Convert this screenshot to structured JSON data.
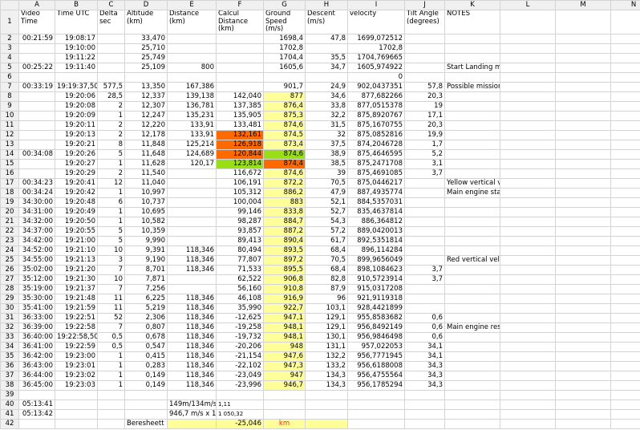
{
  "columns": [
    "",
    "A",
    "B",
    "C",
    "D",
    "E",
    "F",
    "G",
    "H",
    "I",
    "J",
    "K",
    "L",
    "M",
    "N",
    "O"
  ],
  "header_row": {
    "num": "1",
    "cells": [
      "Video Time",
      "Time UTC",
      "Delta sec",
      "Altitude (km)",
      "Distance (km)",
      "Calcul Distance (km)",
      "Ground Speed (m/s)",
      "Descent (m/s)",
      "velocity",
      "Tilt Angle (degrees)",
      "NOTES",
      "",
      "",
      ""
    ]
  },
  "colors": {
    "orange": "#ff6a00",
    "green": "#9ade18",
    "yellow": "#ffff9a",
    "header_bg": "#f0f0f0",
    "grid": "#d4d4d4",
    "red_text": "#ff2a2a"
  },
  "rows": [
    {
      "num": "2",
      "cells": [
        "00:21:59",
        "19:08:17",
        "",
        "33,470",
        "",
        "",
        "1698,4",
        "47,8",
        "1699,072512",
        "",
        "",
        "",
        "",
        ""
      ]
    },
    {
      "num": "3",
      "cells": [
        "",
        "19:10:00",
        "",
        "25,710",
        "",
        "",
        "1702,8",
        "",
        "1702,8",
        "",
        "",
        "",
        "",
        ""
      ]
    },
    {
      "num": "4",
      "cells": [
        "",
        "19:11:22",
        "",
        "25,749",
        "",
        "",
        "1704,4",
        "35,5",
        "1704,769665",
        "",
        "",
        "",
        "",
        ""
      ]
    },
    {
      "num": "5",
      "cells": [
        "00:25:22",
        "19:11:40",
        "",
        "25,109",
        "800",
        "",
        "1605,6",
        "34,7",
        "1605,974922",
        "",
        "Start Landing maneuver",
        "",
        "",
        ""
      ]
    },
    {
      "num": "6",
      "cells": [
        "",
        "",
        "",
        "",
        "",
        "",
        "",
        "",
        "0",
        "",
        "",
        "",
        "",
        ""
      ]
    },
    {
      "num": "7",
      "cells": [
        "00:33:19",
        "19:19:37,50",
        "577,5",
        "13,350",
        "167,386",
        "",
        "901,7",
        "24,9",
        "902,0437351",
        "57,8",
        "Possible mission anomaly began here, Main engine off?",
        "",
        "",
        ""
      ]
    },
    {
      "num": "8",
      "cells": [
        "",
        "19:20:06",
        "28,5",
        "12,337",
        "139,138",
        "142,040",
        "877",
        "34,6",
        "877,682266",
        "20,3",
        "",
        "",
        "",
        ""
      ]
    },
    {
      "num": "9",
      "cells": [
        "",
        "19:20:08",
        "2",
        "12,307",
        "136,781",
        "137,385",
        "876,4",
        "33,8",
        "877,0515378",
        "19",
        "",
        "",
        "",
        ""
      ]
    },
    {
      "num": "10",
      "cells": [
        "",
        "19:20:09",
        "1",
        "12,247",
        "135,231",
        "135,905",
        "875,3",
        "32,2",
        "875,8920767",
        "17,1",
        "",
        "",
        "",
        ""
      ]
    },
    {
      "num": "11",
      "cells": [
        "",
        "19:20:11",
        "2",
        "12,220",
        "133,91",
        "133,481",
        "874,6",
        "31,5",
        "875,1670755",
        "20,3",
        "",
        "",
        "",
        ""
      ]
    },
    {
      "num": "12",
      "cells": [
        "",
        "19:20:13",
        "2",
        "12,178",
        "133,91",
        "132,161",
        "874,5",
        "32",
        "875,0852816",
        "19,9",
        "",
        "",
        "",
        ""
      ]
    },
    {
      "num": "13",
      "cells": [
        "",
        "19:20:21",
        "8",
        "11,848",
        "125,214",
        "126,918",
        "873,4",
        "37,5",
        "874,2046728",
        "1,7",
        "",
        "",
        "",
        ""
      ]
    },
    {
      "num": "14",
      "cells": [
        "00:34:08",
        "19:20:26",
        "5",
        "11,648",
        "124,689",
        "120,844",
        "874,6",
        "38,9",
        "875,4646595",
        "5,2",
        "",
        "",
        "",
        ""
      ]
    },
    {
      "num": "15",
      "cells": [
        "",
        "19:20:27",
        "1",
        "11,628",
        "120,17",
        "123,814",
        "874,4",
        "38,5",
        "875,2471708",
        "3,1",
        "",
        "",
        "",
        ""
      ]
    },
    {
      "num": "16",
      "cells": [
        "",
        "19:20:29",
        "2",
        "11,540",
        "",
        "116,672",
        "874,6",
        "39",
        "875,4691085",
        "3,7",
        "",
        "",
        "",
        ""
      ]
    },
    {
      "num": "17",
      "cells": [
        "00:34:23",
        "19:20:41",
        "12",
        "11,040",
        "",
        "106,191",
        "872,2",
        "70,5",
        "875,0446217",
        "",
        "Yellow vertical velocity alarm",
        "",
        "",
        ""
      ]
    },
    {
      "num": "18",
      "cells": [
        "00:34:24",
        "19:20:42",
        "1",
        "10,997",
        "",
        "105,312",
        "886,2",
        "47,9",
        "887,4935774",
        "",
        "Main engine starts again? Followed by intermittent firings,",
        "",
        "",
        ""
      ]
    },
    {
      "num": "19",
      "cells": [
        "34:30:00",
        "19:20:48",
        "6",
        "10,737",
        "",
        "100,004",
        "883",
        "52,1",
        "884,5357031",
        "",
        "",
        "",
        "",
        ""
      ]
    },
    {
      "num": "20",
      "cells": [
        "34:31:00",
        "19:20:49",
        "1",
        "10,695",
        "",
        "99,146",
        "833,8",
        "52,7",
        "835,4637814",
        "",
        "",
        "",
        "",
        ""
      ]
    },
    {
      "num": "21",
      "cells": [
        "34:32:00",
        "19:20:50",
        "1",
        "10,582",
        "",
        "98,287",
        "884,7",
        "54,3",
        "886,364812",
        "",
        "",
        "",
        "",
        ""
      ]
    },
    {
      "num": "22",
      "cells": [
        "34:37:00",
        "19:20:55",
        "5",
        "10,359",
        "",
        "93,857",
        "887,2",
        "57,2",
        "889,0420013",
        "",
        "",
        "",
        "",
        ""
      ]
    },
    {
      "num": "23",
      "cells": [
        "34:42:00",
        "19:21:00",
        "5",
        "9,990",
        "",
        "89,413",
        "890,4",
        "61,7",
        "892,5351814",
        "",
        "",
        "",
        "",
        ""
      ]
    },
    {
      "num": "24",
      "cells": [
        "34:52:00",
        "19:21:10",
        "10",
        "9,391",
        "118,346",
        "80,494",
        "893,5",
        "68,4",
        "896,114284",
        "",
        "",
        "",
        "",
        ""
      ]
    },
    {
      "num": "25",
      "cells": [
        "34:55:00",
        "19:21:13",
        "3",
        "9,190",
        "118,346",
        "77,807",
        "897,2",
        "70,5",
        "899,9656049",
        "",
        "Red vertical velocity alarm",
        "",
        "",
        ""
      ]
    },
    {
      "num": "26",
      "cells": [
        "35:02:00",
        "19:21:20",
        "7",
        "8,701",
        "118,346",
        "71,533",
        "895,5",
        "68,4",
        "898,1084623",
        "3,7",
        "",
        "",
        "",
        ""
      ]
    },
    {
      "num": "27",
      "cells": [
        "35:12:00",
        "19:21:30",
        "10",
        "7,871",
        "",
        "62,522",
        "906,8",
        "82,8",
        "910,5723914",
        "3,7",
        "",
        "",
        "",
        ""
      ]
    },
    {
      "num": "28",
      "cells": [
        "35:19:00",
        "19:21:37",
        "7",
        "7,256",
        "",
        "56,160",
        "910,8",
        "87,9",
        "915,0317208",
        "",
        "",
        "",
        "",
        ""
      ]
    },
    {
      "num": "29",
      "cells": [
        "35:30:00",
        "19:21:48",
        "11",
        "6,225",
        "118,346",
        "46,108",
        "916,9",
        "96",
        "921,9119318",
        "",
        "",
        "",
        "",
        ""
      ]
    },
    {
      "num": "30",
      "cells": [
        "35:41:00",
        "19:21:59",
        "11",
        "5,219",
        "118,346",
        "35,990",
        "922,7",
        "103,1",
        "928,4421899",
        "",
        "",
        "",
        "",
        ""
      ]
    },
    {
      "num": "31",
      "cells": [
        "36:33:00",
        "19:22:51",
        "52",
        "2,306",
        "118,346",
        "-12,625",
        "947,1",
        "129,1",
        "955,8583682",
        "0,6",
        "",
        "",
        "",
        ""
      ]
    },
    {
      "num": "32",
      "cells": [
        "36:39:00",
        "19:22:58",
        "7",
        "0,807",
        "118,346",
        "-19,258",
        "948,1",
        "129,1",
        "956,8492149",
        "0,6",
        "Main engine restart",
        "",
        "",
        ""
      ]
    },
    {
      "num": "33",
      "cells": [
        "36:40:00",
        "19:22:58,50",
        "0,5",
        "0,678",
        "118,346",
        "-19,732",
        "948,1",
        "130,1",
        "956,9846498",
        "0,6",
        "",
        "",
        "",
        ""
      ]
    },
    {
      "num": "34",
      "cells": [
        "36:41:00",
        "19:22:59",
        "0,5",
        "0,547",
        "118,346",
        "-20,206",
        "948",
        "131,1",
        "957,022053",
        "34,1",
        "",
        "",
        "",
        ""
      ]
    },
    {
      "num": "35",
      "cells": [
        "36:42:00",
        "19:23:00",
        "1",
        "0,415",
        "118,346",
        "-21,154",
        "947,6",
        "132,2",
        "956,7771945",
        "34,1",
        "",
        "",
        "",
        ""
      ]
    },
    {
      "num": "36",
      "cells": [
        "36:43:00",
        "19:23:01",
        "1",
        "0,283",
        "118,346",
        "-22,102",
        "947,3",
        "133,2",
        "956,6188008",
        "34,3",
        "",
        "",
        "",
        ""
      ]
    },
    {
      "num": "37",
      "cells": [
        "36:44:00",
        "19:23:02",
        "1",
        "0,149",
        "118,346",
        "-23,049",
        "947",
        "134,3",
        "956,4755564",
        "34,3",
        "",
        "",
        "",
        ""
      ]
    },
    {
      "num": "38",
      "cells": [
        "36:45:00",
        "19:23:03",
        "1",
        "0,149",
        "118,346",
        "-23,996",
        "946,7",
        "134,3",
        "956,1785294",
        "34,3",
        "",
        "",
        "",
        ""
      ]
    },
    {
      "num": "39",
      "cells": [
        "",
        "",
        "",
        "",
        "",
        "",
        "",
        "",
        "",
        "",
        "",
        "",
        "",
        ""
      ]
    },
    {
      "num": "40",
      "cells": [
        "05:13:41",
        "",
        "",
        "",
        "149m/134m/s*",
        "1,11",
        "",
        "",
        "",
        "",
        "",
        "",
        "",
        ""
      ]
    },
    {
      "num": "41",
      "cells": [
        "05:13:42",
        "",
        "",
        "",
        "946,7 m/s x 1,11",
        "1 050,32",
        "",
        "",
        "",
        "",
        "",
        "",
        "",
        ""
      ]
    },
    {
      "num": "42",
      "cells": [
        "",
        "",
        "",
        "Beresheett impact distance",
        "",
        "-25,046",
        "km",
        "",
        "",
        "",
        "",
        "",
        "",
        ""
      ]
    }
  ]
}
